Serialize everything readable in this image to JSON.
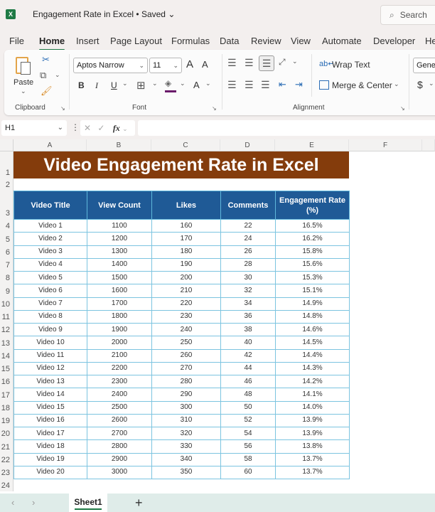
{
  "titlebar": {
    "app_icon": "X",
    "doc_title": "Engagement Rate in Excel • Saved ⌄",
    "search_placeholder": "Search"
  },
  "menu": [
    "File",
    "Home",
    "Insert",
    "Page Layout",
    "Formulas",
    "Data",
    "Review",
    "View",
    "Automate",
    "Developer",
    "He"
  ],
  "ribbon": {
    "clipboard": {
      "paste": "Paste",
      "label": "Clipboard"
    },
    "font": {
      "font_name": "Aptos Narrow",
      "font_size": "11",
      "bold": "B",
      "italic": "I",
      "underline": "U",
      "grow": "A",
      "shrink": "A",
      "font_color": "A",
      "label": "Font"
    },
    "alignment": {
      "wrap_text": "Wrap Text",
      "merge_center": "Merge & Center",
      "label": "Alignment"
    },
    "number": {
      "format": "Gener",
      "currency": "$"
    }
  },
  "formula_bar": {
    "name_box": "H1",
    "fx": "fx",
    "formula": ""
  },
  "columns": [
    "A",
    "B",
    "C",
    "D",
    "E",
    "F"
  ],
  "rows": [
    "1",
    "2",
    "3",
    "4",
    "5",
    "6",
    "7",
    "8",
    "9",
    "10",
    "11",
    "12",
    "13",
    "14",
    "15",
    "16",
    "17",
    "18",
    "19",
    "20",
    "21",
    "22",
    "23",
    "24"
  ],
  "sheet_title": "Video Engagement Rate in Excel",
  "table": {
    "headers": [
      "Video Title",
      "View Count",
      "Likes",
      "Comments",
      "Engagement Rate (%)"
    ],
    "rows": [
      [
        "Video 1",
        "1100",
        "160",
        "22",
        "16.5%"
      ],
      [
        "Video 2",
        "1200",
        "170",
        "24",
        "16.2%"
      ],
      [
        "Video 3",
        "1300",
        "180",
        "26",
        "15.8%"
      ],
      [
        "Video 4",
        "1400",
        "190",
        "28",
        "15.6%"
      ],
      [
        "Video 5",
        "1500",
        "200",
        "30",
        "15.3%"
      ],
      [
        "Video 6",
        "1600",
        "210",
        "32",
        "15.1%"
      ],
      [
        "Video 7",
        "1700",
        "220",
        "34",
        "14.9%"
      ],
      [
        "Video 8",
        "1800",
        "230",
        "36",
        "14.8%"
      ],
      [
        "Video 9",
        "1900",
        "240",
        "38",
        "14.6%"
      ],
      [
        "Video 10",
        "2000",
        "250",
        "40",
        "14.5%"
      ],
      [
        "Video 11",
        "2100",
        "260",
        "42",
        "14.4%"
      ],
      [
        "Video 12",
        "2200",
        "270",
        "44",
        "14.3%"
      ],
      [
        "Video 13",
        "2300",
        "280",
        "46",
        "14.2%"
      ],
      [
        "Video 14",
        "2400",
        "290",
        "48",
        "14.1%"
      ],
      [
        "Video 15",
        "2500",
        "300",
        "50",
        "14.0%"
      ],
      [
        "Video 16",
        "2600",
        "310",
        "52",
        "13.9%"
      ],
      [
        "Video 17",
        "2700",
        "320",
        "54",
        "13.9%"
      ],
      [
        "Video 18",
        "2800",
        "330",
        "56",
        "13.8%"
      ],
      [
        "Video 19",
        "2900",
        "340",
        "58",
        "13.7%"
      ],
      [
        "Video 20",
        "3000",
        "350",
        "60",
        "13.7%"
      ]
    ]
  },
  "sheets": {
    "active": "Sheet1",
    "add": "+"
  },
  "colors": {
    "title_band": "#843c0c",
    "header_fill": "#1f5a96",
    "grid_border": "#7cc4e0",
    "accent": "#1f7a45"
  }
}
